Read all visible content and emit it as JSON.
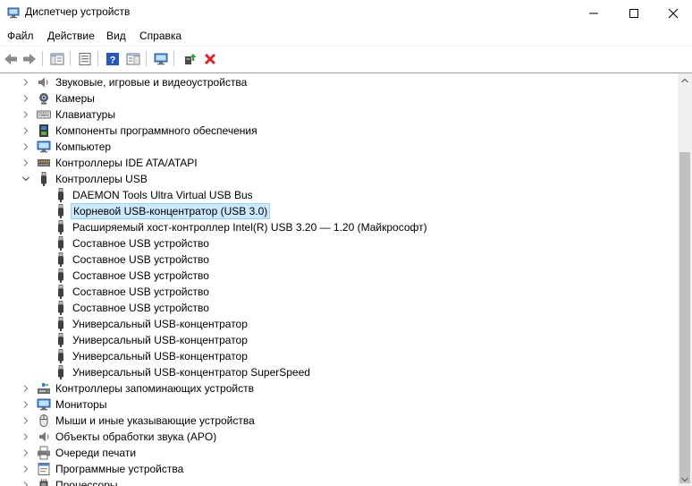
{
  "window": {
    "title": "Диспетчер устройств",
    "controls": [
      "minimize",
      "maximize",
      "close"
    ]
  },
  "menu": [
    "Файл",
    "Действие",
    "Вид",
    "Справка"
  ],
  "toolbar": {
    "icons": [
      "back-icon",
      "forward-icon",
      "show-hide-tree-icon",
      "properties-icon",
      "help-icon",
      "action-pane-icon",
      "scan-hardware-icon",
      "update-driver-icon",
      "uninstall-icon"
    ]
  },
  "tree": {
    "selected_item": "Корневой USB-концентратор (USB 3.0)",
    "items": [
      {
        "label": "Звуковые, игровые и видеоустройства",
        "level": 1,
        "state": "collapsed",
        "icon": "speaker-icon"
      },
      {
        "label": "Камеры",
        "level": 1,
        "state": "collapsed",
        "icon": "camera-icon"
      },
      {
        "label": "Клавиатуры",
        "level": 1,
        "state": "collapsed",
        "icon": "keyboard-icon"
      },
      {
        "label": "Компоненты программного обеспечения",
        "level": 1,
        "state": "collapsed",
        "icon": "software-component-icon"
      },
      {
        "label": "Компьютер",
        "level": 1,
        "state": "collapsed",
        "icon": "computer-icon"
      },
      {
        "label": "Контроллеры IDE ATA/ATAPI",
        "level": 1,
        "state": "collapsed",
        "icon": "ide-controller-icon"
      },
      {
        "label": "Контроллеры USB",
        "level": 1,
        "state": "expanded",
        "icon": "usb-icon"
      },
      {
        "label": "DAEMON Tools Ultra Virtual USB Bus",
        "level": 2,
        "state": "leaf",
        "icon": "usb-icon"
      },
      {
        "label": "Корневой USB-концентратор (USB 3.0)",
        "level": 2,
        "state": "leaf",
        "icon": "usb-icon"
      },
      {
        "label": "Расширяемый хост-контроллер Intel(R) USB 3.20 — 1.20 (Майкрософт)",
        "level": 2,
        "state": "leaf",
        "icon": "usb-icon"
      },
      {
        "label": "Составное USB устройство",
        "level": 2,
        "state": "leaf",
        "icon": "usb-icon"
      },
      {
        "label": "Составное USB устройство",
        "level": 2,
        "state": "leaf",
        "icon": "usb-icon"
      },
      {
        "label": "Составное USB устройство",
        "level": 2,
        "state": "leaf",
        "icon": "usb-icon"
      },
      {
        "label": "Составное USB устройство",
        "level": 2,
        "state": "leaf",
        "icon": "usb-icon"
      },
      {
        "label": "Составное USB устройство",
        "level": 2,
        "state": "leaf",
        "icon": "usb-icon"
      },
      {
        "label": "Универсальный USB-концентратор",
        "level": 2,
        "state": "leaf",
        "icon": "usb-icon"
      },
      {
        "label": "Универсальный USB-концентратор",
        "level": 2,
        "state": "leaf",
        "icon": "usb-icon"
      },
      {
        "label": "Универсальный USB-концентратор",
        "level": 2,
        "state": "leaf",
        "icon": "usb-icon"
      },
      {
        "label": "Универсальный USB-концентратор SuperSpeed",
        "level": 2,
        "state": "leaf",
        "icon": "usb-icon"
      },
      {
        "label": "Контроллеры запоминающих устройств",
        "level": 1,
        "state": "collapsed",
        "icon": "storage-controller-icon"
      },
      {
        "label": "Мониторы",
        "level": 1,
        "state": "collapsed",
        "icon": "monitor-icon"
      },
      {
        "label": "Мыши и иные указывающие устройства",
        "level": 1,
        "state": "collapsed",
        "icon": "mouse-icon"
      },
      {
        "label": "Объекты обработки звука (APO)",
        "level": 1,
        "state": "collapsed",
        "icon": "audio-processing-icon"
      },
      {
        "label": "Очереди печати",
        "level": 1,
        "state": "collapsed",
        "icon": "printer-icon"
      },
      {
        "label": "Программные устройства",
        "level": 1,
        "state": "collapsed",
        "icon": "software-device-icon"
      },
      {
        "label": "Процессоры",
        "level": 1,
        "state": "collapsed",
        "icon": "processor-icon"
      }
    ]
  },
  "colors": {
    "selection_bg": "#cce8ff",
    "selection_border": "#99d1ff",
    "close_red": "#d9262c",
    "help_blue": "#2b57b8"
  }
}
